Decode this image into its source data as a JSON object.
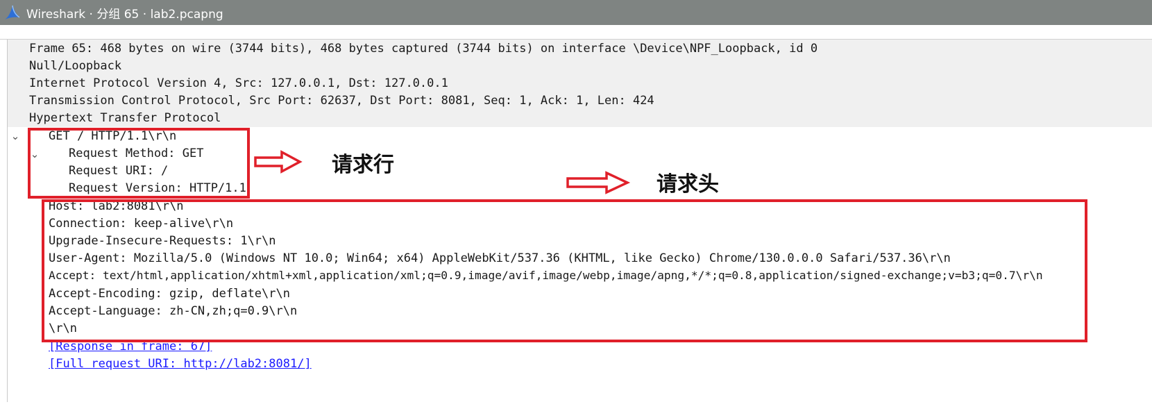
{
  "window": {
    "title": "Wireshark · 分组 65 · lab2.pcapng",
    "icon": "wireshark-fin-icon"
  },
  "tree": {
    "frame": "Frame 65: 468 bytes on wire (3744 bits), 468 bytes captured (3744 bits) on interface \\Device\\NPF_Loopback, id 0",
    "null_loopback": "Null/Loopback",
    "ip": "Internet Protocol Version 4, Src: 127.0.0.1, Dst: 127.0.0.1",
    "tcp": "Transmission Control Protocol, Src Port: 62637, Dst Port: 8081, Seq: 1, Ack: 1, Len: 424",
    "http": "Hypertext Transfer Protocol",
    "request_line": "GET / HTTP/1.1\\r\\n",
    "request_method": "Request Method: GET",
    "request_uri": "Request URI: /",
    "request_version": "Request Version: HTTP/1.1",
    "headers": [
      "Host: lab2:8081\\r\\n",
      "Connection: keep-alive\\r\\n",
      "Upgrade-Insecure-Requests: 1\\r\\n",
      "User-Agent: Mozilla/5.0 (Windows NT 10.0; Win64; x64) AppleWebKit/537.36 (KHTML, like Gecko) Chrome/130.0.0.0 Safari/537.36\\r\\n",
      "Accept: text/html,application/xhtml+xml,application/xml;q=0.9,image/avif,image/webp,image/apng,*/*;q=0.8,application/signed-exchange;v=b3;q=0.7\\r\\n",
      "Accept-Encoding: gzip, deflate\\r\\n",
      "Accept-Language: zh-CN,zh;q=0.9\\r\\n",
      "\\r\\n"
    ],
    "response_link": "[Response in frame: 67]",
    "full_uri_link": "[Full request URI: http://lab2:8081/]"
  },
  "annotations": {
    "request_line_label": "请求行",
    "request_header_label": "请求头",
    "color": "#e0202a"
  }
}
